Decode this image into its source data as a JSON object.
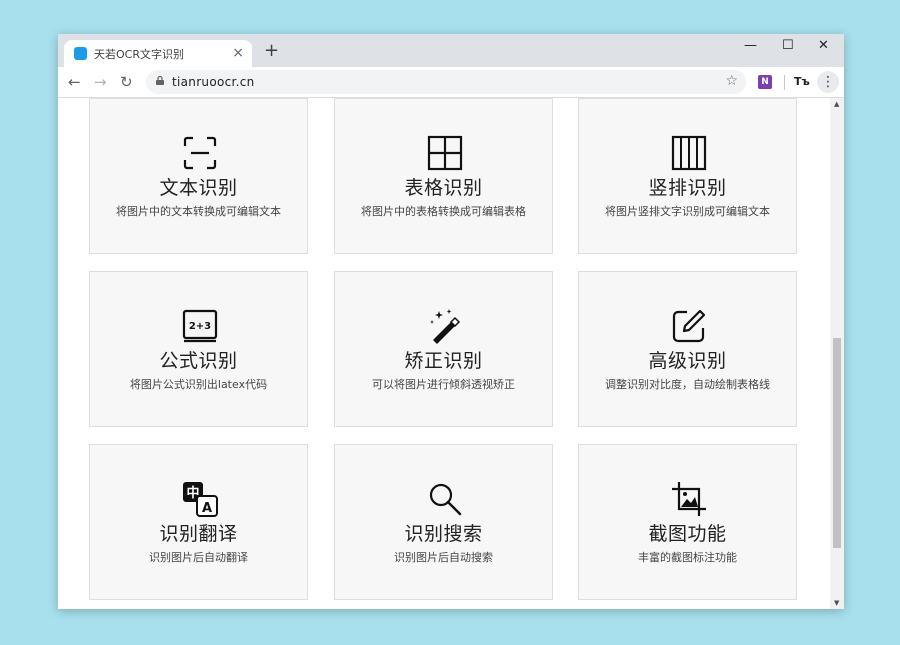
{
  "browser": {
    "tab_title": "天若OCR文字识别",
    "tab_close": "×",
    "new_tab": "+",
    "url": "tianruoocr.cn",
    "minimize": "—",
    "maximize": "☐",
    "close": "✕",
    "back": "←",
    "forward": "→",
    "reload": "↻",
    "star": "☆",
    "ext_onenote": "N",
    "ext_tb": "Tъ",
    "menu": "⋮"
  },
  "cards": [
    {
      "title": "文本识别",
      "desc": "将图片中的文本转换成可编辑文本",
      "icon": "scan-text-icon"
    },
    {
      "title": "表格识别",
      "desc": "将图片中的表格转换成可编辑表格",
      "icon": "table-grid-icon"
    },
    {
      "title": "竖排识别",
      "desc": "将图片竖排文字识别成可编辑文本",
      "icon": "vertical-columns-icon"
    },
    {
      "title": "公式识别",
      "desc": "将图片公式识别出latex代码",
      "icon": "formula-board-icon",
      "icon_text": "2+3"
    },
    {
      "title": "矫正识别",
      "desc": "可以将图片进行倾斜透视矫正",
      "icon": "magic-wand-icon"
    },
    {
      "title": "高级识别",
      "desc": "调整识别对比度，自动绘制表格线",
      "icon": "edit-square-icon"
    },
    {
      "title": "识别翻译",
      "desc": "识别图片后自动翻译",
      "icon": "translate-icon",
      "icon_text_zh": "中",
      "icon_text_en": "A"
    },
    {
      "title": "识别搜索",
      "desc": "识别图片后自动搜索",
      "icon": "search-icon"
    },
    {
      "title": "截图功能",
      "desc": "丰富的截图标注功能",
      "icon": "crop-image-icon"
    }
  ],
  "colors": {
    "page_bg": "#a8e0ee",
    "card_bg": "#f7f7f7",
    "card_border": "#dedede",
    "favicon": "#1e9be6",
    "onenote": "#7b3fb0"
  }
}
